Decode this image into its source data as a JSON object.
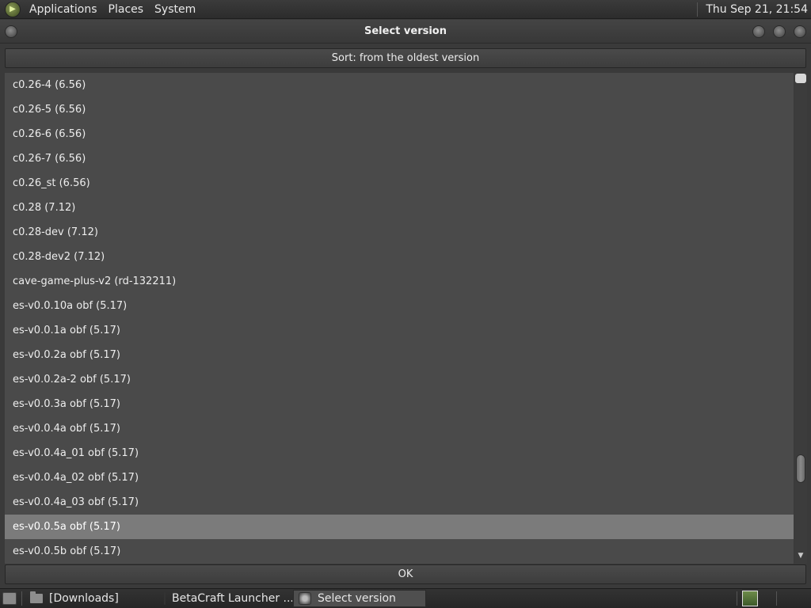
{
  "top_panel": {
    "menus": [
      "Applications",
      "Places",
      "System"
    ],
    "clock": "Thu Sep 21, 21:54"
  },
  "window": {
    "title": "Select version",
    "sort_label": "Sort: from the oldest version",
    "ok_label": "OK"
  },
  "list": {
    "items": [
      "c0.26-4 (6.56)",
      "c0.26-5 (6.56)",
      "c0.26-6 (6.56)",
      "c0.26-7 (6.56)",
      "c0.26_st (6.56)",
      "c0.28 (7.12)",
      "c0.28-dev (7.12)",
      "c0.28-dev2 (7.12)",
      "cave-game-plus-v2 (rd-132211)",
      "es-v0.0.10a obf (5.17)",
      "es-v0.0.1a obf (5.17)",
      "es-v0.0.2a obf (5.17)",
      "es-v0.0.2a-2 obf (5.17)",
      "es-v0.0.3a obf (5.17)",
      "es-v0.0.4a obf (5.17)",
      "es-v0.0.4a_01 obf (5.17)",
      "es-v0.0.4a_02 obf (5.17)",
      "es-v0.0.4a_03 obf (5.17)",
      "es-v0.0.5a obf (5.17)",
      "es-v0.0.5b obf (5.17)"
    ],
    "selected_index": 18
  },
  "scrollbar": {
    "position_fraction": 0.85
  },
  "taskbar": {
    "tasks": [
      {
        "label": "[Downloads]",
        "icon": "folder-icon"
      },
      {
        "label": "BetaCraft Launcher ...",
        "icon": "betacraft-icon"
      },
      {
        "label": "Select version",
        "icon": "betacraft-icon"
      }
    ],
    "active_index": 2
  }
}
